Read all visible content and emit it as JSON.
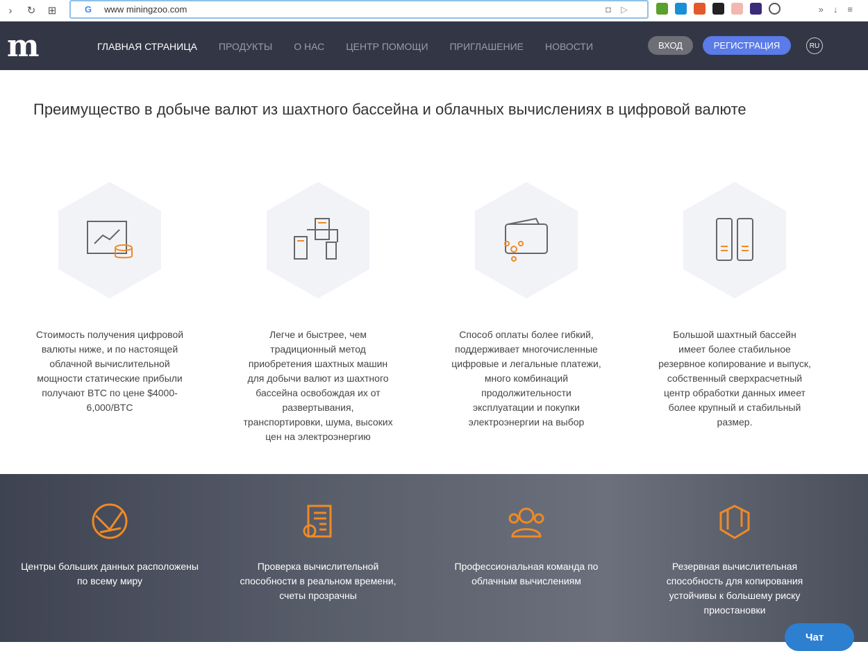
{
  "browser": {
    "url": "www  miningzoo.com"
  },
  "nav": {
    "logo": "m",
    "items": [
      "ГЛАВНАЯ СТРАНИЦА",
      "ПРОДУКТЫ",
      "О НАС",
      "ЦЕНТР ПОМОЩИ",
      "ПРИГЛАШЕНИЕ",
      "НОВОСТИ"
    ],
    "login": "ВХОД",
    "register": "РЕГИСТРАЦИЯ",
    "lang": "RU"
  },
  "headline": "Преимущество в добыче валют из шахтного бассейна и облачных вычислениях в цифровой валюте",
  "features": [
    "Стоимость получения цифровой валюты ниже, и по настоящей облачной вычислительной мощности статические прибыли получают BTC по цене $4000-6,000/BTC",
    "Легче и быстрее, чем традиционный метод приобретения шахтных машин для добычи валют из шахтного бассейна освобождая их от развертывания, транспортировки, шума, высоких цен на электроэнергию",
    "Способ оплаты более гибкий, поддерживает многочисленные цифровые и легальные платежи, много комбинаций продолжительности эксплуатации и покупки электроэнергии на выбор",
    "Большой шахтный бассейн имеет более стабильное резервное копирование и выпуск, собственный сверхрасчетный центр обработки данных имеет более крупный и стабильный размер."
  ],
  "advantages": [
    "Центры больших данных расположены по всему миру",
    "Проверка вычислительной способности в реальном времени, счеты прозрачны",
    "Профессиональная команда по облачным вычислениям",
    "Резервная вычислительная способность для копирования устойчивы к большему риску приостановки"
  ],
  "chat": "Чат",
  "colors": {
    "accent": "#f08a24",
    "nav": "#333645",
    "register": "#5a7be8"
  }
}
